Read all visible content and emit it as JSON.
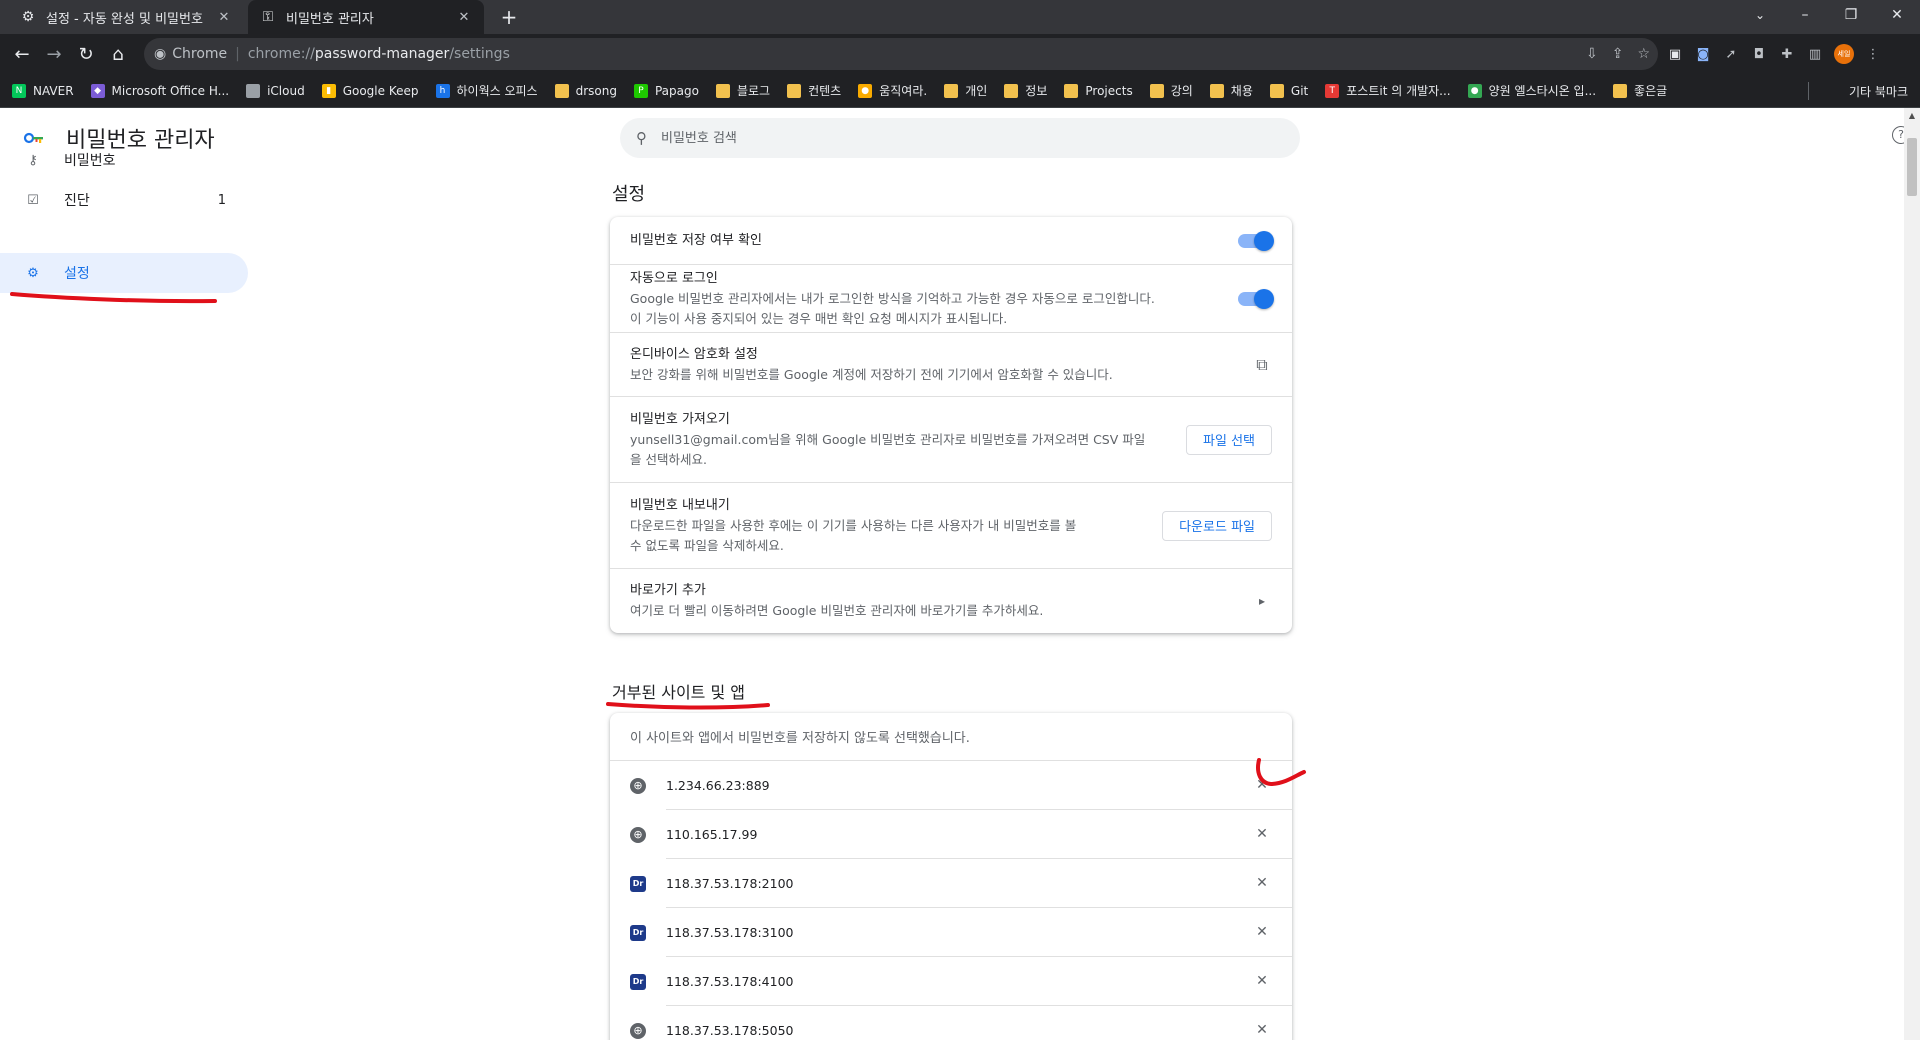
{
  "browser": {
    "tabs": [
      {
        "title": "설정 - 자동 완성 및 비밀번호",
        "icon": "gear-icon"
      },
      {
        "title": "비밀번호 관리자",
        "icon": "key-icon"
      }
    ],
    "omnibox": {
      "chip": "Chrome",
      "url_scheme": "chrome://",
      "url_host": "password-manager",
      "url_path": "/settings"
    },
    "avatar_label": "세일",
    "bookmarks": [
      {
        "label": "NAVER",
        "icon": "naver-icon",
        "color": "#03c75a"
      },
      {
        "label": "Microsoft Office H...",
        "icon": "office-icon",
        "color": "#7b5cd6"
      },
      {
        "label": "iCloud",
        "icon": "apple-icon",
        "color": "#9aa0a6"
      },
      {
        "label": "Google Keep",
        "icon": "keep-icon",
        "color": "#fbbc04"
      },
      {
        "label": "하이웍스 오피스",
        "icon": "hiworks-icon",
        "color": "#1a73e8"
      },
      {
        "label": "drsong",
        "icon": "folder-icon",
        "color": "#f2c14e"
      },
      {
        "label": "Papago",
        "icon": "papago-icon",
        "color": "#1ec800"
      },
      {
        "label": "블로그",
        "icon": "folder-icon",
        "color": "#f2c14e"
      },
      {
        "label": "컨텐츠",
        "icon": "folder-icon",
        "color": "#f2c14e"
      },
      {
        "label": "움직여라.",
        "icon": "bulb-icon",
        "color": "#f9ab00"
      },
      {
        "label": "개인",
        "icon": "folder-icon",
        "color": "#f2c14e"
      },
      {
        "label": "정보",
        "icon": "folder-icon",
        "color": "#f2c14e"
      },
      {
        "label": "Projects",
        "icon": "folder-icon",
        "color": "#f2c14e"
      },
      {
        "label": "강의",
        "icon": "folder-icon",
        "color": "#f2c14e"
      },
      {
        "label": "채용",
        "icon": "folder-icon",
        "color": "#f2c14e"
      },
      {
        "label": "Git",
        "icon": "folder-icon",
        "color": "#f2c14e"
      },
      {
        "label": "포스트it 의 개발자...",
        "icon": "postit-icon",
        "color": "#e53935"
      },
      {
        "label": "양원 엘스타시온 입...",
        "icon": "site-icon",
        "color": "#34a853"
      },
      {
        "label": "좋은글",
        "icon": "folder-icon",
        "color": "#f2c14e"
      }
    ],
    "other_bookmarks": "기타 북마크"
  },
  "app": {
    "title": "비밀번호 관리자",
    "nav": [
      {
        "label": "비밀번호",
        "icon": "key-icon",
        "badge": ""
      },
      {
        "label": "진단",
        "icon": "checkup-icon",
        "badge": "1"
      },
      {
        "label": "설정",
        "icon": "gear-icon",
        "badge": ""
      }
    ],
    "search_placeholder": "비밀번호 검색"
  },
  "settings": {
    "heading": "설정",
    "offer_save": {
      "title": "비밀번호 저장 여부 확인",
      "enabled": true
    },
    "auto_signin": {
      "title": "자동으로 로그인",
      "desc1": "Google 비밀번호 관리자에서는 내가 로그인한 방식을 기억하고 가능한 경우 자동으로 로그인합니다.",
      "desc2": "이 기능이 사용 중지되어 있는 경우 매번 확인 요청 메시지가 표시됩니다.",
      "enabled": true
    },
    "ondevice": {
      "title": "온디바이스 암호화 설정",
      "desc": "보안 강화를 위해 비밀번호를 Google 계정에 저장하기 전에 기기에서 암호화할 수 있습니다."
    },
    "import": {
      "title": "비밀번호 가져오기",
      "desc1": "yunsell31@gmail.com님을 위해 Google 비밀번호 관리자로 비밀번호를 가져오려면 CSV 파일",
      "desc2": "을 선택하세요.",
      "button": "파일 선택"
    },
    "export": {
      "title": "비밀번호 내보내기",
      "desc1": "다운로드한 파일을 사용한 후에는 이 기기를 사용하는 다른 사용자가 내 비밀번호를 볼",
      "desc2": "수 없도록 파일을 삭제하세요.",
      "button": "다운로드 파일"
    },
    "shortcut": {
      "title": "바로가기 추가",
      "desc": "여기로 더 빨리 이동하려면 Google 비밀번호 관리자에 바로가기를 추가하세요."
    }
  },
  "blocked": {
    "heading": "거부된 사이트 및 앱",
    "description": "이 사이트와 앱에서 비밀번호를 저장하지 않도록 선택했습니다.",
    "sites": [
      {
        "name": "1.234.66.23:889",
        "icon": "globe-icon"
      },
      {
        "name": "110.165.17.99",
        "icon": "globe-icon"
      },
      {
        "name": "118.37.53.178:2100",
        "icon": "dr-app-icon"
      },
      {
        "name": "118.37.53.178:3100",
        "icon": "dr-app-icon"
      },
      {
        "name": "118.37.53.178:4100",
        "icon": "dr-app-icon"
      },
      {
        "name": "118.37.53.178:5050",
        "icon": "globe-icon"
      }
    ]
  },
  "colors": {
    "accent": "#1a73e8",
    "annotation": "#e0101a"
  }
}
